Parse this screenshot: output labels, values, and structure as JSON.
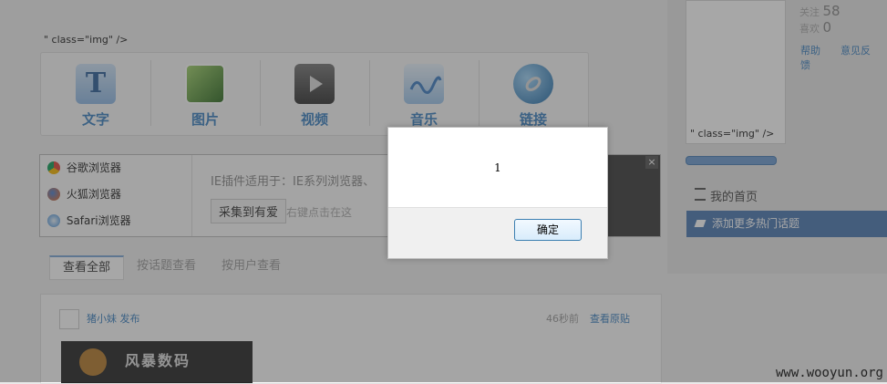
{
  "page": {
    "img_attr_text": "\" class=\"img\" />",
    "right_img_attr_text": "\" class=\"img\" />"
  },
  "toolbar": {
    "items": [
      {
        "label": "文字",
        "icon": "text-icon",
        "color": "#5b8fd0"
      },
      {
        "label": "图片",
        "icon": "picture-icon",
        "color": "#4e8f2e"
      },
      {
        "label": "视频",
        "icon": "video-icon",
        "color": "#555555"
      },
      {
        "label": "音乐",
        "icon": "music-icon",
        "color": "#4a8fd8"
      },
      {
        "label": "链接",
        "icon": "link-icon",
        "color": "#2f7fb8"
      }
    ]
  },
  "plugin": {
    "browsers": [
      {
        "label": "谷歌浏览器",
        "icon": "chrome-icon"
      },
      {
        "label": "火狐浏览器",
        "icon": "firefox-icon"
      },
      {
        "label": "Safari浏览器",
        "icon": "safari-icon"
      }
    ],
    "description": "IE插件适用于：IE系列浏览器、",
    "collect_button": "采集到有爱",
    "hint": "右键点击在这",
    "close": "×"
  },
  "tabs": [
    "查看全部",
    "按话题查看",
    "按用户查看"
  ],
  "post": {
    "user": "猪小妹  发布",
    "time": "46秒前",
    "view_original": "查看原贴",
    "banner_text": "风暴数码"
  },
  "sidebar": {
    "stats": [
      {
        "label": "关注",
        "value": "58"
      },
      {
        "label": "喜欢",
        "value": "0"
      }
    ],
    "links": [
      "帮助",
      "意见反馈"
    ],
    "my_home": "我的首页",
    "add_topic": "添加更多热门话题"
  },
  "dialog": {
    "message": "1",
    "ok_label": "确定"
  },
  "watermark": "www.wooyun.org"
}
